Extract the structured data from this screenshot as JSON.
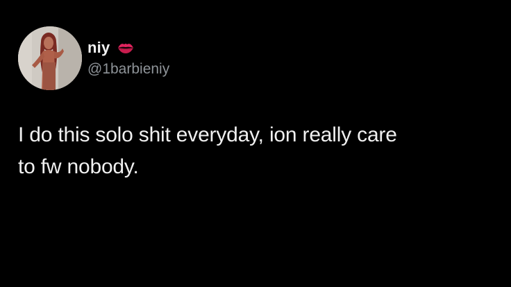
{
  "user": {
    "display_name": "niy",
    "handle": "@1barbieniy",
    "badge_icon": "kiss-mark-icon",
    "badge_color": "#e0245e"
  },
  "tweet": {
    "text_line1": "I do this solo shit everyday, ion really care",
    "text_line2": "to fw nobody."
  },
  "colors": {
    "background": "#000000",
    "name": "#f2f2f2",
    "handle": "#8e9398",
    "text": "#f0f0f0"
  }
}
